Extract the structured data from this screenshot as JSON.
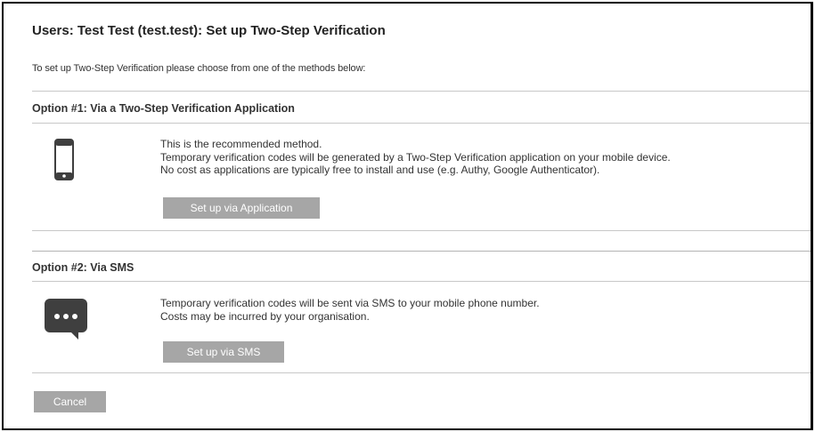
{
  "page": {
    "title": "Users: Test Test (test.test): Set up Two-Step Verification",
    "intro": "To set up Two-Step Verification please choose from one of the methods below:"
  },
  "options": [
    {
      "title": "Option #1: Via a Two-Step Verification Application",
      "icon": "mobile-phone-icon",
      "lines": [
        "This is the recommended method.",
        "Temporary verification codes will be generated by a Two-Step Verification application on your mobile device.",
        "No cost as applications are typically free to install and use (e.g. Authy, Google Authenticator)."
      ],
      "button_label": "Set up via Application"
    },
    {
      "title": "Option #2: Via SMS",
      "icon": "sms-chat-bubble-icon",
      "lines": [
        "Temporary verification codes will be sent via SMS to your mobile phone number.",
        "Costs may be incurred by your organisation."
      ],
      "button_label": "Set up via SMS"
    }
  ],
  "actions": {
    "cancel_label": "Cancel"
  },
  "colors": {
    "button_bg": "#a6a6a6",
    "button_text": "#ffffff",
    "icon": "#3f3f3f",
    "divider": "#c8c8c8",
    "frame_border": "#000000"
  }
}
